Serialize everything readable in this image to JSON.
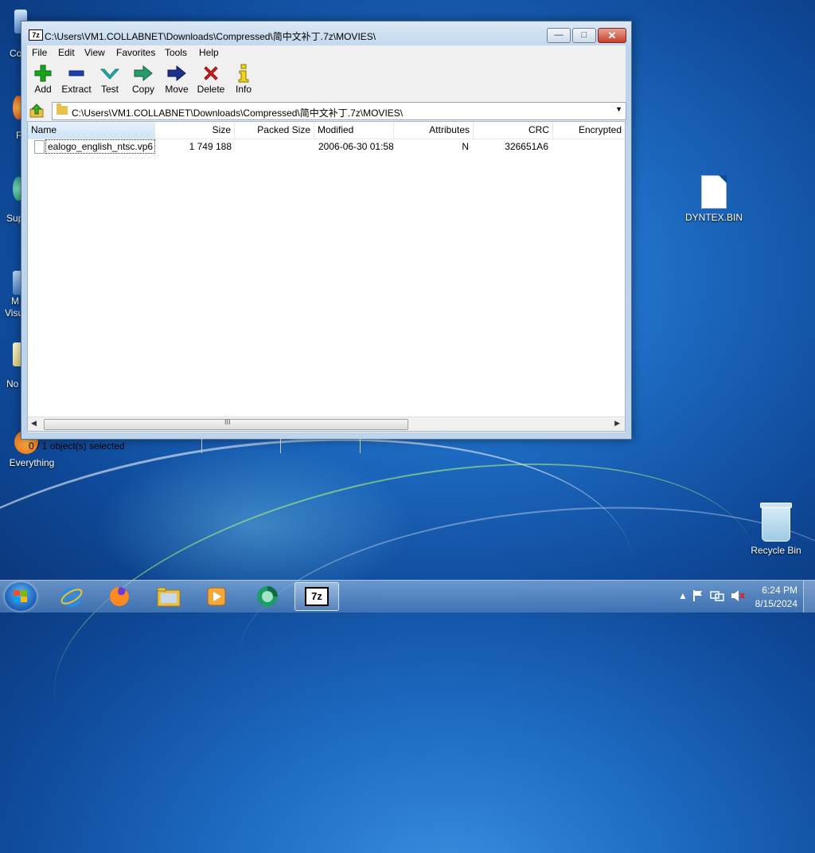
{
  "window": {
    "title": "C:\\Users\\VM1.COLLABNET\\Downloads\\Compressed\\简中文补丁.7z\\MOVIES\\",
    "app_icon_label": "7z"
  },
  "menu": [
    "File",
    "Edit",
    "View",
    "Favorites",
    "Tools",
    "Help"
  ],
  "toolbar": [
    {
      "label": "Add",
      "icon": "plus",
      "color": "#1aa31a"
    },
    {
      "label": "Extract",
      "icon": "minus",
      "color": "#1e3fae"
    },
    {
      "label": "Test",
      "icon": "check",
      "color": "#20b4b4"
    },
    {
      "label": "Copy",
      "icon": "arrow-right",
      "color": "#2a9a6a"
    },
    {
      "label": "Move",
      "icon": "arrow-right",
      "color": "#1e2f8e"
    },
    {
      "label": "Delete",
      "icon": "x",
      "color": "#d81e1e"
    },
    {
      "label": "Info",
      "icon": "info",
      "color": "#c9a800"
    }
  ],
  "address": {
    "path": "C:\\Users\\VM1.COLLABNET\\Downloads\\Compressed\\简中文补丁.7z\\MOVIES\\"
  },
  "columns": [
    "Name",
    "Size",
    "Packed Size",
    "Modified",
    "Attributes",
    "CRC",
    "Encrypted"
  ],
  "files": [
    {
      "name": "ealogo_english_ntsc.vp6",
      "size": "1 749 188",
      "packed_size": "",
      "modified": "2006-06-30 01:58",
      "attributes": "N",
      "crc": "326651A6",
      "encrypted": ""
    }
  ],
  "scrollbar": {
    "grip": "III"
  },
  "status": {
    "selection": "0 / 1 object(s) selected"
  },
  "desktop": {
    "icons": [
      {
        "label": "DYNTEX.BIN"
      },
      {
        "label": "Recycle Bin"
      },
      {
        "label": "Everything"
      }
    ],
    "partial_labels": [
      "Co",
      "F",
      "Sup",
      "M",
      "Visu",
      "No"
    ]
  },
  "taskbar": {
    "apps": [
      "internet-explorer",
      "firefox",
      "file-explorer",
      "media-player",
      "browser",
      "7zip"
    ],
    "active_label": "7z",
    "time": "6:24 PM",
    "date": "8/15/2024",
    "tray_glyphs": {
      "expand": "▲"
    }
  }
}
